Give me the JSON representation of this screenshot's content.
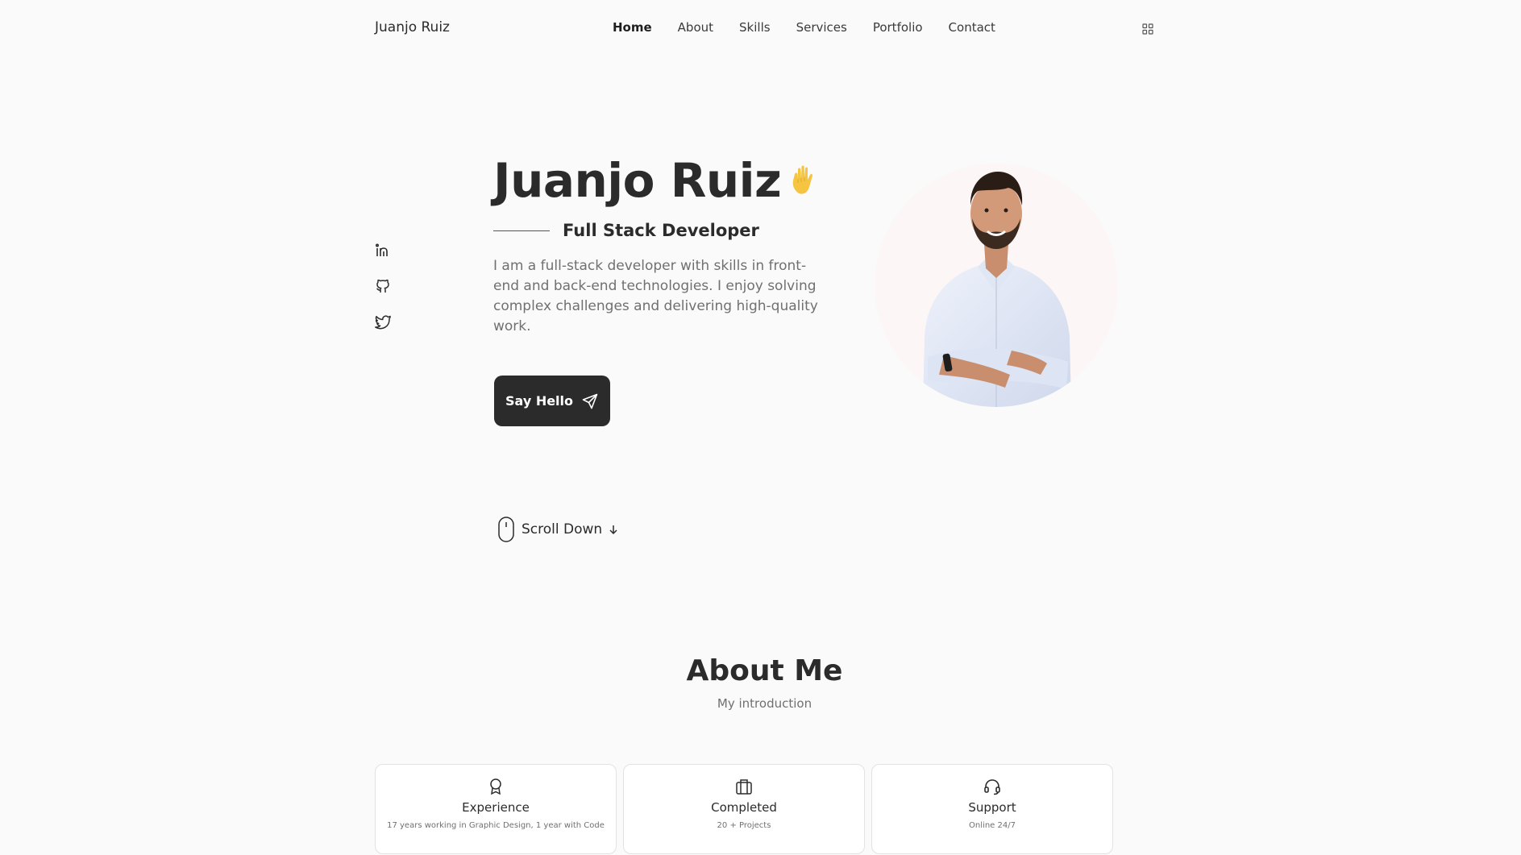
{
  "header": {
    "logo": "Juanjo Ruiz",
    "nav": [
      "Home",
      "About",
      "Skills",
      "Services",
      "Portfolio",
      "Contact"
    ],
    "active_nav": "Home",
    "menu_icon": "grid-icon"
  },
  "social": {
    "icons": [
      "linkedin-icon",
      "github-icon",
      "twitter-icon"
    ]
  },
  "hero": {
    "name": "Juanjo Ruiz",
    "wave_icon": "waving-hand-icon",
    "subtitle": "Full Stack Developer",
    "description": "I am a full-stack developer with skills in front-end and back-end technologies. I enjoy solving complex challenges and delivering high-quality work.",
    "cta_label": "Say Hello",
    "cta_icon": "send-icon",
    "scroll_label": "Scroll Down"
  },
  "about": {
    "title": "About Me",
    "subtitle": "My introduction",
    "cards": [
      {
        "icon": "award-icon",
        "title": "Experience",
        "subtitle": "17 years working in Graphic Design, 1 year with Code"
      },
      {
        "icon": "briefcase-icon",
        "title": "Completed",
        "subtitle": "20 + Projects"
      },
      {
        "icon": "headset-icon",
        "title": "Support",
        "subtitle": "Online 24/7"
      }
    ]
  },
  "colors": {
    "background": "#fafafa",
    "text": "#2b2b2b",
    "muted": "#707070",
    "button": "#2b2b2b",
    "wave": "#f5c542"
  }
}
